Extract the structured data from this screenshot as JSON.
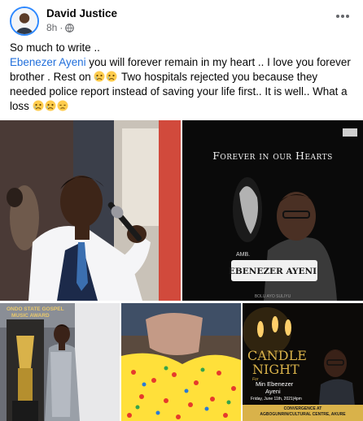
{
  "post": {
    "author": "David Justice",
    "time": "8h",
    "separator": "·",
    "privacy_icon": "globe-icon",
    "more_icon": "more-options-icon"
  },
  "text": {
    "line1": "So much to write ..",
    "mention": "Ebenezer Ayeni",
    "part2": " you will forever remain in my heart .. I love you forever brother . Rest on ",
    "part3": " Two hospitals rejected you because they needed police report instead of saving your life first.. It is well.. What a loss ",
    "emoji": "crying-face-emoji"
  },
  "photos": {
    "memorial": {
      "heading": "Forever in our Hearts",
      "prefix": "AMB.",
      "name": "EBENEZER AYENI",
      "footer": "BOLU AYO SULIYU"
    },
    "award": {
      "plaque_line1": "ONDO STATE GOSPEL",
      "plaque_line2": "MUSIC AWARD"
    },
    "candle": {
      "title1": "CANDLE",
      "title2": "NIGHT",
      "for": "For",
      "name1": "Min Ebenezer",
      "name2": "Ayeni",
      "date": "Friday, June 11th, 2021|4pm",
      "venue_label": "CONVERGENCE AT",
      "venue": "AGBOGUNRIN/CULTURAL CENTRE, AKURE"
    }
  },
  "colors": {
    "mention": "#216fdb",
    "secondary_text": "#65676b",
    "gold": "#d9b24a"
  }
}
